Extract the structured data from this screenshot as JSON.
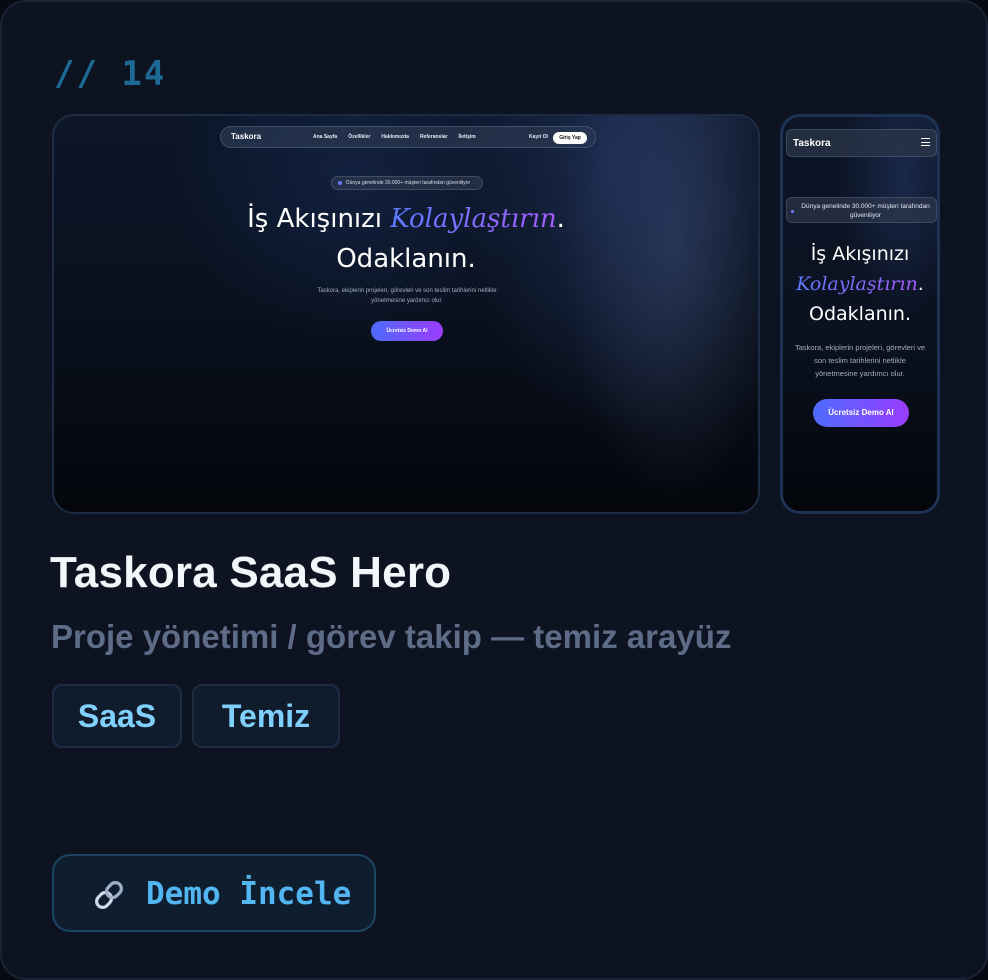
{
  "card": {
    "index": "// 14",
    "title": "Taskora SaaS Hero",
    "subtitle": "Proje yönetimi / görev takip — temiz arayüz",
    "tags": [
      "SaaS",
      "Temiz"
    ],
    "action": {
      "label": "Demo İncele",
      "icon": "link-icon"
    }
  },
  "preview_desktop": {
    "logo": "Taskora",
    "nav_links": [
      "Ana Sayfa",
      "Özellikler",
      "Hakkımızda",
      "Referanslar",
      "İletişim"
    ],
    "register": "Kayıt Ol",
    "login": "Giriş Yap",
    "badge": "Dünya genelinde 30.000+ müşteri tarafından güveniliyor",
    "heading_line1_start": "İş Akışınızı ",
    "heading_accent": "Kolaylaştırın",
    "heading_line1_end": ".",
    "heading_line2": "Odaklanın.",
    "description_line1": "Taskora, ekiplerin projeleri, görevleri ve son teslim tarihlerini netlikle",
    "description_line2": "yönetmesine yardımcı olur.",
    "cta": "Ücretsiz Demo Al"
  },
  "preview_mobile": {
    "logo": "Taskora",
    "badge_line1": "Dünya genelinde 30.000+ müşteri tarafından",
    "badge_line2": "güveniliyor",
    "heading_line1": "İş Akışınızı",
    "heading_accent": "Kolaylaştırın",
    "heading_accent_end": ".",
    "heading_line3": "Odaklanın.",
    "description_line1": "Taskora, ekiplerin projeleri, görevleri ve",
    "description_line2": "son teslim tarihlerini netlikle",
    "description_line3": "yönetmesine yardımcı olur.",
    "cta": "Ücretsiz Demo Al"
  },
  "colors": {
    "card_bg": "#0d1320",
    "accent_blue": "#52b6f3",
    "tag_text": "#7fd0ff",
    "gradient_start": "#4d6bff",
    "gradient_end": "#9b3cff"
  }
}
